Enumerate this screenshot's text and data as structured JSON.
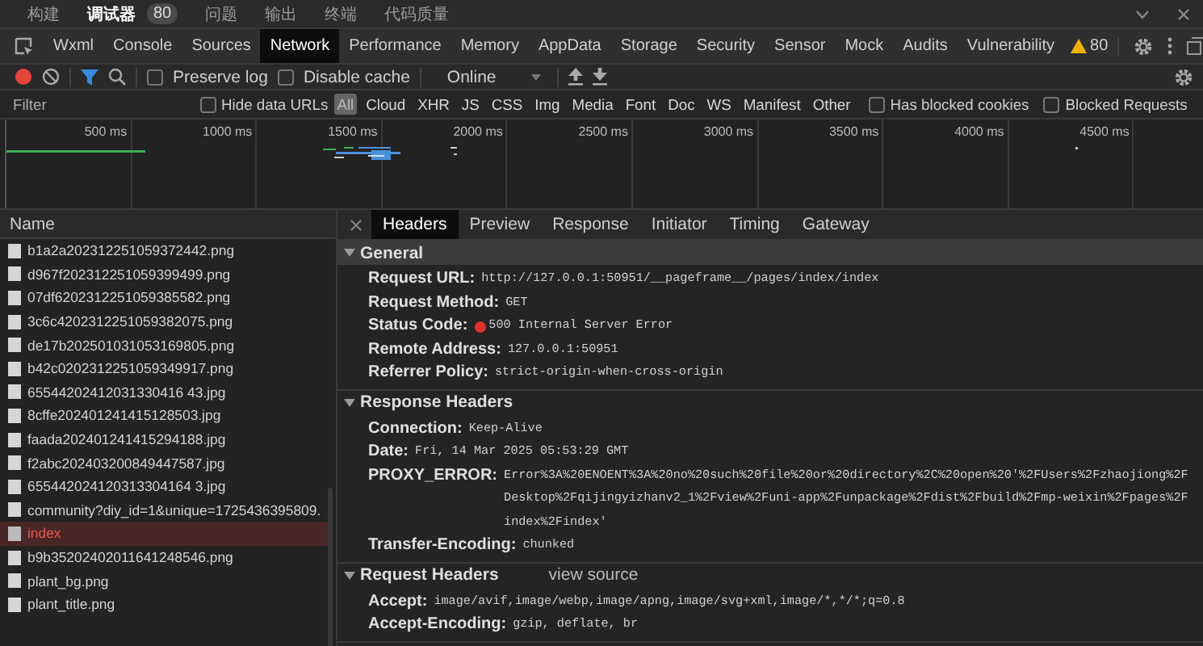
{
  "top_tabs": [
    {
      "label": "构建",
      "selected": false
    },
    {
      "label": "调试器",
      "selected": true,
      "badge": "80"
    },
    {
      "label": "问题",
      "selected": false
    },
    {
      "label": "输出",
      "selected": false
    },
    {
      "label": "终端",
      "selected": false
    },
    {
      "label": "代码质量",
      "selected": false
    }
  ],
  "panel_tabs": [
    {
      "label": "Wxml",
      "selected": false
    },
    {
      "label": "Console",
      "selected": false
    },
    {
      "label": "Sources",
      "selected": false
    },
    {
      "label": "Network",
      "selected": true
    },
    {
      "label": "Performance",
      "selected": false
    },
    {
      "label": "Memory",
      "selected": false
    },
    {
      "label": "AppData",
      "selected": false
    },
    {
      "label": "Storage",
      "selected": false
    },
    {
      "label": "Security",
      "selected": false
    },
    {
      "label": "Sensor",
      "selected": false
    },
    {
      "label": "Mock",
      "selected": false
    },
    {
      "label": "Audits",
      "selected": false
    },
    {
      "label": "Vulnerability",
      "selected": false
    }
  ],
  "warning_count": "80",
  "toolbar": {
    "recording": true,
    "preserve_log": {
      "label": "Preserve log",
      "checked": false
    },
    "disable_cache": {
      "label": "Disable cache",
      "checked": false
    },
    "throttling": "Online"
  },
  "filter": {
    "placeholder": "Filter",
    "hide_data_urls": {
      "label": "Hide data URLs",
      "checked": false
    },
    "types": [
      {
        "label": "All",
        "selected": true
      },
      {
        "label": "Cloud",
        "selected": false
      },
      {
        "label": "XHR",
        "selected": false
      },
      {
        "label": "JS",
        "selected": false
      },
      {
        "label": "CSS",
        "selected": false
      },
      {
        "label": "Img",
        "selected": false
      },
      {
        "label": "Media",
        "selected": false
      },
      {
        "label": "Font",
        "selected": false
      },
      {
        "label": "Doc",
        "selected": false
      },
      {
        "label": "WS",
        "selected": false
      },
      {
        "label": "Manifest",
        "selected": false
      },
      {
        "label": "Other",
        "selected": false
      }
    ],
    "has_blocked_cookies": {
      "label": "Has blocked cookies",
      "checked": false
    },
    "blocked_requests": {
      "label": "Blocked Requests",
      "checked": false
    }
  },
  "timeline": {
    "ticks": [
      "500 ms",
      "1000 ms",
      "1500 ms",
      "2000 ms",
      "2500 ms",
      "3000 ms",
      "3500 ms",
      "4000 ms",
      "4500 ms"
    ]
  },
  "requests": {
    "column": "Name",
    "items": [
      {
        "name": "b1a2a202312251059372442.png",
        "selected": false
      },
      {
        "name": "d967f202312251059399499.png",
        "selected": false
      },
      {
        "name": "07df6202312251059385582.png",
        "selected": false
      },
      {
        "name": "3c6c4202312251059382075.png",
        "selected": false
      },
      {
        "name": "de17b202501031053169805.png",
        "selected": false
      },
      {
        "name": "b42c0202312251059349917.png",
        "selected": false
      },
      {
        "name": "65544202412031330416 43.jpg",
        "selected": false
      },
      {
        "name": "8cffe202401241415128503.jpg",
        "selected": false
      },
      {
        "name": "faada202401241415294188.jpg",
        "selected": false
      },
      {
        "name": "f2abc202403200849447587.jpg",
        "selected": false
      },
      {
        "name": "655442024120313304164 3.jpg",
        "selected": false
      },
      {
        "name": "community?diy_id=1&unique=1725436395809.",
        "selected": false
      },
      {
        "name": "index",
        "selected": true
      },
      {
        "name": "b9b35202402011641248546.png",
        "selected": false
      },
      {
        "name": "plant_bg.png",
        "selected": false
      },
      {
        "name": "plant_title.png",
        "selected": false
      }
    ]
  },
  "details": {
    "tabs": [
      {
        "label": "Headers",
        "selected": true
      },
      {
        "label": "Preview",
        "selected": false
      },
      {
        "label": "Response",
        "selected": false
      },
      {
        "label": "Initiator",
        "selected": false
      },
      {
        "label": "Timing",
        "selected": false
      },
      {
        "label": "Gateway",
        "selected": false
      }
    ],
    "sections": [
      {
        "title": "General",
        "expanded": true,
        "rows": [
          {
            "kind": "plain",
            "name": "Request URL:",
            "value": "http://127.0.0.1:50951/__pageframe__/pages/index/index"
          },
          {
            "kind": "plain",
            "name": "Request Method:",
            "value": "GET"
          },
          {
            "kind": "status",
            "name": "Status Code:",
            "value": "500 Internal Server Error"
          },
          {
            "kind": "plain",
            "name": "Remote Address:",
            "value": "127.0.0.1:50951"
          },
          {
            "kind": "plain",
            "name": "Referrer Policy:",
            "value": "strict-origin-when-cross-origin"
          }
        ]
      },
      {
        "title": "Response Headers",
        "expanded": true,
        "rows": [
          {
            "kind": "plain",
            "name": "Connection:",
            "value": "Keep-Alive"
          },
          {
            "kind": "plain",
            "name": "Date:",
            "value": "Fri, 14 Mar 2025 05:53:29 GMT"
          },
          {
            "kind": "plain",
            "name": "PROXY_ERROR:",
            "value": "Error%3A%20ENOENT%3A%20no%20such%20file%20or%20directory%2C%20open%20'%2FUsers%2Fzhaojiong%2FDesktop%2Fqijingyizhanv2_1%2Fview%2Funi-app%2Funpackage%2Fdist%2Fbuild%2Fmp-weixin%2Fpages%2Findex%2Findex'"
          },
          {
            "kind": "plain",
            "name": "Transfer-Encoding:",
            "value": "chunked"
          }
        ]
      },
      {
        "title": "Request Headers",
        "expanded": true,
        "link": "view source",
        "rows": [
          {
            "kind": "plain",
            "name": "Accept:",
            "value": "image/avif,image/webp,image/apng,image/svg+xml,image/*,*/*;q=0.8"
          },
          {
            "kind": "plain",
            "name": "Accept-Encoding:",
            "value": "gzip, deflate, br"
          }
        ]
      }
    ]
  }
}
